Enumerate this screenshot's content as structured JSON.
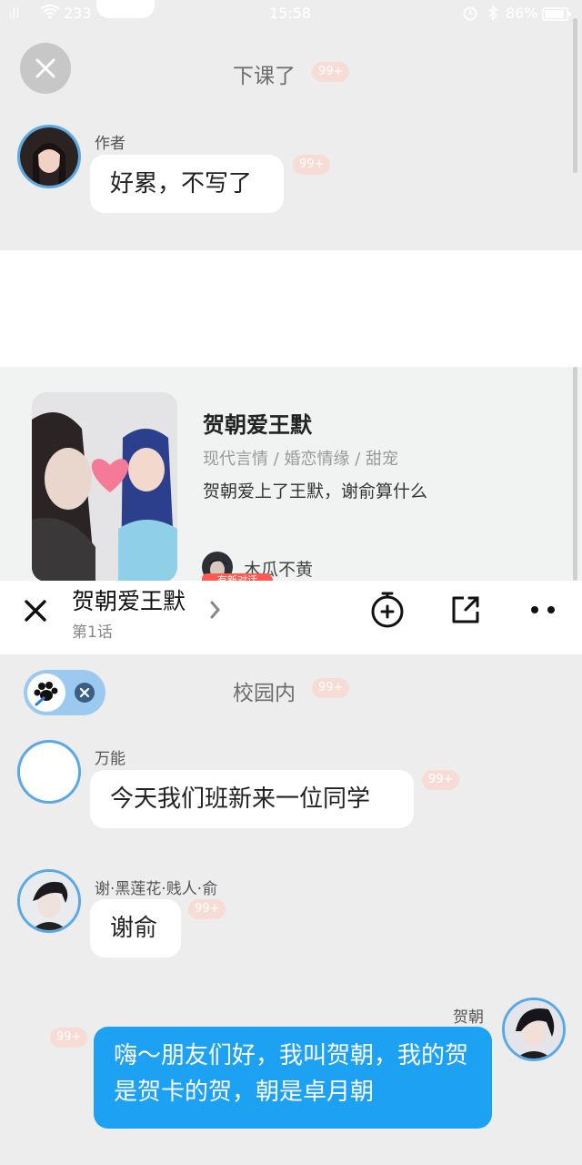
{
  "status_bar": {
    "signal": "ᵢll",
    "wifi_speed": "233",
    "time": "15:58",
    "battery": "86%"
  },
  "top_scene": {
    "title": "下课了",
    "badge": "99+",
    "message": {
      "sender": "作者",
      "text": "好累，不写了",
      "badge": "99+"
    }
  },
  "story_card": {
    "title": "贺朝爱王默",
    "tags": "现代言情 / 婚恋情缘 / 甜宠",
    "description": "贺朝爱上了王默，谢俞算什么",
    "author": "木瓜不黄",
    "author_tag": "有新对话"
  },
  "toolbar": {
    "close_icon": "close-icon",
    "title": "贺朝爱王默",
    "episode": "第1话",
    "chevron": "›"
  },
  "bottom_scene": {
    "title": "校园内",
    "badge": "99+",
    "messages": [
      {
        "sender": "万能",
        "text": "今天我们班新来一位同学",
        "badge": "99+"
      },
      {
        "sender": "谢·黑莲花·贱人·俞",
        "text": "谢俞",
        "badge": "99+"
      },
      {
        "sender": "贺朝",
        "text": "嗨～朋友们好，我叫贺朝，我的贺是贺卡的贺，朝是卓月朝",
        "badge": "99+"
      }
    ]
  },
  "colors": {
    "accent_blue": "#1da1f2",
    "avatar_ring": "#5aa9e6",
    "badge_bg": "#f7dcd6"
  }
}
